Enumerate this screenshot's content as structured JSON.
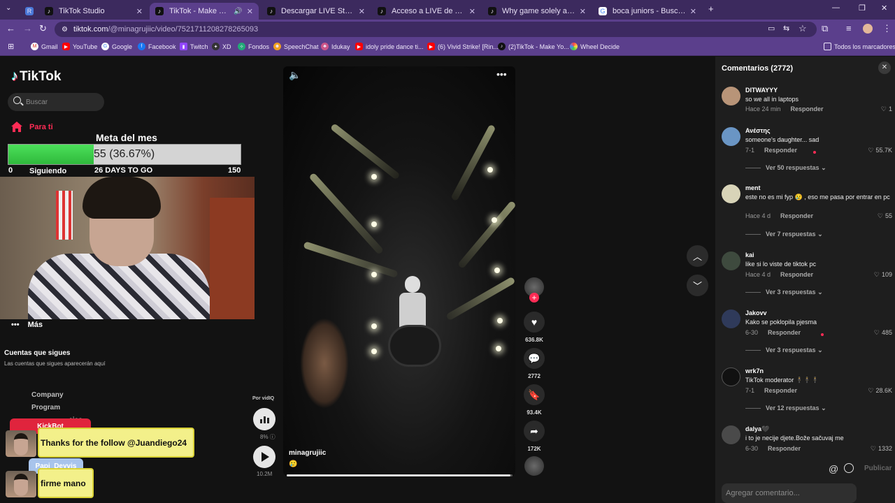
{
  "browser": {
    "tabs": [
      {
        "label": "TikTok Studio",
        "active": false
      },
      {
        "label": "TikTok - Make Your Day",
        "active": true
      },
      {
        "label": "Descargar LIVE Studio | TikTok",
        "active": false
      },
      {
        "label": "Acceso a LIVE de TikTok",
        "active": false
      },
      {
        "label": "Why game solely as a hobby at",
        "active": false
      },
      {
        "label": "boca juniors - Buscar con Goog",
        "active": false
      }
    ],
    "url_host": "tiktok.com",
    "url_path": "/@minagrujiic/video/7521711208278265093",
    "bookmarks": [
      "Gmail",
      "YouTube",
      "Google",
      "Facebook",
      "Twitch",
      "XD",
      "Fondos",
      "SpeechChat",
      "Idukay",
      "idoly pride dance ti...",
      "(6) Vivid Strike! [Rin...",
      "(2)TikTok - Make Yo...",
      "Wheel Decide"
    ],
    "bookmarks_all": "Todos los marcadores",
    "colors": {
      "frame": "#3c2a5e",
      "toolbar": "#5b3f8c"
    }
  },
  "sidebar": {
    "logo": "TikTok",
    "search_placeholder": "Buscar",
    "nav": [
      {
        "label": "Para ti",
        "icon": "home-icon",
        "color": "#fe2c55"
      },
      {
        "label": "Siguiendo",
        "icon": "following-icon"
      },
      {
        "label": "Más",
        "icon": "more-icon"
      }
    ],
    "following_heading": "Cuentas que sigues",
    "following_sub": "Las cuentas que sigues aparecerán aquí",
    "footer": [
      "Company",
      "Program",
      "...cies"
    ]
  },
  "overlay": {
    "goal_title": "Meta del mes",
    "goal_text": "55 (36.67%)",
    "goal_progress": 0.3667,
    "goal_start": "0",
    "goal_end": "150",
    "goal_days": "26 DAYS TO GO"
  },
  "chat": [
    {
      "name": "KickBot",
      "message": "Thanks for the follow @Juandiego24",
      "name_color": "#e0243d"
    },
    {
      "name": "Papi_Deyvis",
      "message": "firme mano",
      "name_color": "#a8c4ec"
    }
  ],
  "player": {
    "author": "minagrujiic",
    "caption_emoji": "🥲",
    "progress": 0.99,
    "vidiq_label": "Por vidIQ",
    "vidiq_pct": "8%",
    "play_count": "10.2M"
  },
  "actions": {
    "likes": "636.8K",
    "comments": "2772",
    "saves": "93.4K",
    "shares": "172K"
  },
  "comments_panel": {
    "title": "Comentarios (2772)",
    "input_placeholder": "Agregar comentario...",
    "publish": "Publicar",
    "reply_label": "Responder",
    "items": [
      {
        "user": "DITWAYYY",
        "text": "so we all in laptops",
        "time": "Hace 24 min",
        "likes": "1",
        "more": ""
      },
      {
        "user": "Ανέστης",
        "text": "someone's daughter... sad",
        "time": "7-1",
        "likes": "55.7K",
        "more": "Ver 50 respuestas"
      },
      {
        "user": "ment",
        "text": "este no es mi fyp 😢 , eso me pasa por entrar en pc",
        "time": "Hace 4 d",
        "likes": "55",
        "more": "Ver 7 respuestas"
      },
      {
        "user": "kai",
        "text": "like si lo viste de tiktok pc",
        "time": "Hace 4 d",
        "likes": "109",
        "more": "Ver 3 respuestas"
      },
      {
        "user": "Jakovv",
        "text": "Kako se poklopila pjesma",
        "time": "6-30",
        "likes": "485",
        "more": "Ver 3 respuestas"
      },
      {
        "user": "wrk7n",
        "text": "TikTok moderator 🕴️🕴️🕴️",
        "time": "7-1",
        "likes": "28.6K",
        "more": "Ver 12 respuestas"
      },
      {
        "user": "dalya🖤",
        "text": "i to je necije djete.Bože sačuvaj me",
        "time": "6-30",
        "likes": "1332",
        "more": ""
      }
    ]
  }
}
